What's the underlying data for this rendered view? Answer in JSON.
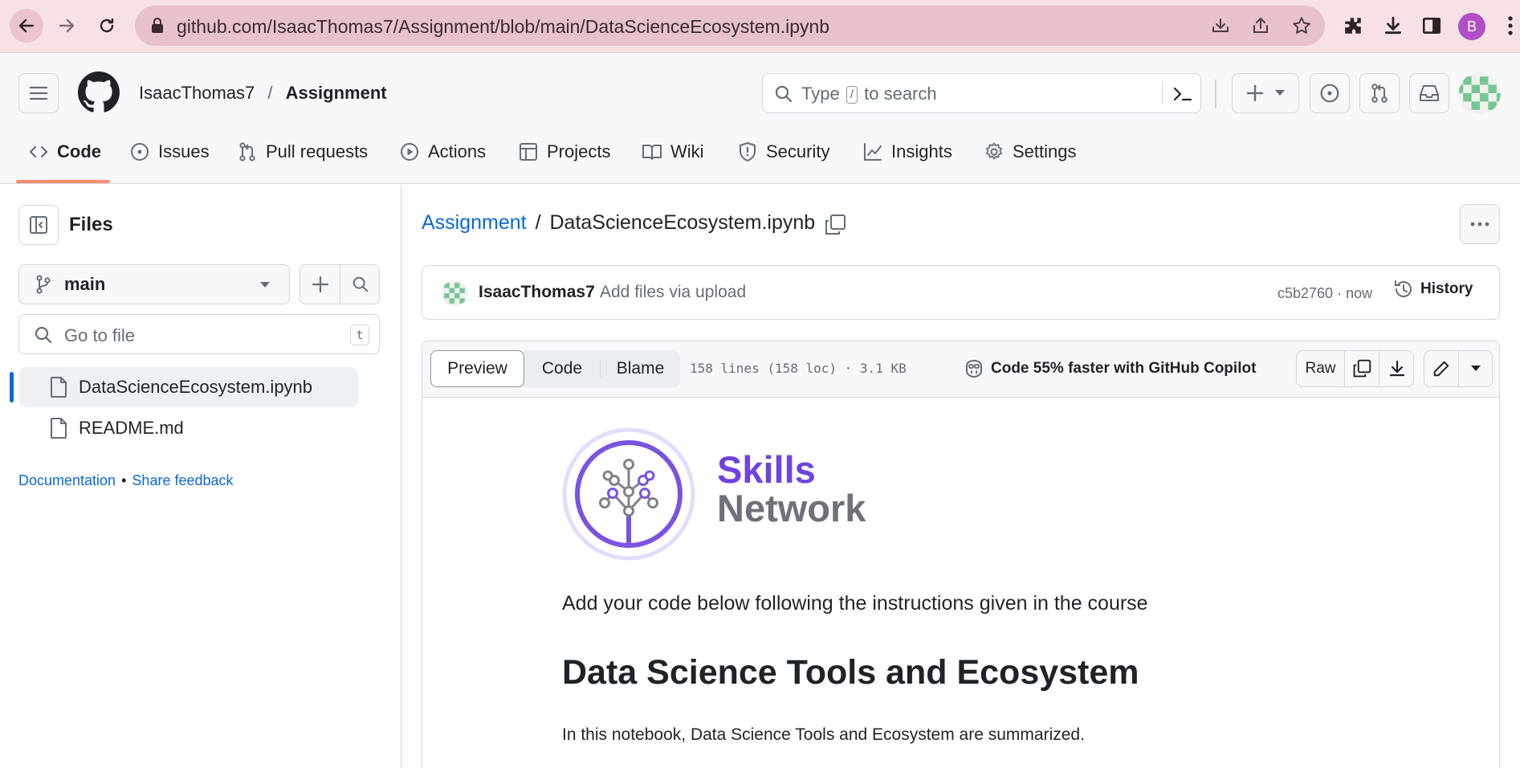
{
  "browser": {
    "url": "github.com/IsaacThomas7/Assignment/blob/main/DataScienceEcosystem.ipynb",
    "profile_initial": "B"
  },
  "header": {
    "owner": "IsaacThomas7",
    "separator": "/",
    "repo": "Assignment",
    "search_prefix": "Type",
    "search_key": "/",
    "search_suffix": "to search"
  },
  "tabs": [
    {
      "label": "Code",
      "icon": "code-icon"
    },
    {
      "label": "Issues",
      "icon": "issue-icon"
    },
    {
      "label": "Pull requests",
      "icon": "pull-request-icon"
    },
    {
      "label": "Actions",
      "icon": "play-icon"
    },
    {
      "label": "Projects",
      "icon": "table-icon"
    },
    {
      "label": "Wiki",
      "icon": "book-icon"
    },
    {
      "label": "Security",
      "icon": "shield-icon"
    },
    {
      "label": "Insights",
      "icon": "graph-icon"
    },
    {
      "label": "Settings",
      "icon": "gear-icon"
    }
  ],
  "sidebar": {
    "title": "Files",
    "branch": "main",
    "goto_placeholder": "Go to file",
    "goto_key": "t",
    "files": [
      {
        "name": "DataScienceEcosystem.ipynb",
        "selected": true
      },
      {
        "name": "README.md",
        "selected": false
      }
    ],
    "footer_doc": "Documentation",
    "footer_sep": "•",
    "footer_feedback": "Share feedback"
  },
  "file": {
    "breadcrumb_repo": "Assignment",
    "breadcrumb_sep": "/",
    "name": "DataScienceEcosystem.ipynb",
    "commit_author": "IsaacThomas7",
    "commit_message": "Add files via upload",
    "commit_hash": "c5b2760",
    "commit_time": "· now",
    "history_label": "History"
  },
  "viewer": {
    "tab_preview": "Preview",
    "tab_code": "Code",
    "tab_blame": "Blame",
    "meta": "158 lines (158 loc) · 3.1 KB",
    "copilot": "Code 55% faster with GitHub Copilot",
    "raw": "Raw"
  },
  "notebook": {
    "logo_line1": "Skills",
    "logo_line2": "Network",
    "instruction": "Add your code below following the instructions given in the course",
    "heading": "Data Science Tools and Ecosystem",
    "intro": "In this notebook, Data Science Tools and Ecosystem are summarized."
  },
  "colors": {
    "accent_blue": "#0969da",
    "tab_underline": "#fd8c73",
    "logo_purple": "#6f42e1",
    "logo_gray": "#6e7177",
    "chrome_pink": "#f7e1e5"
  }
}
